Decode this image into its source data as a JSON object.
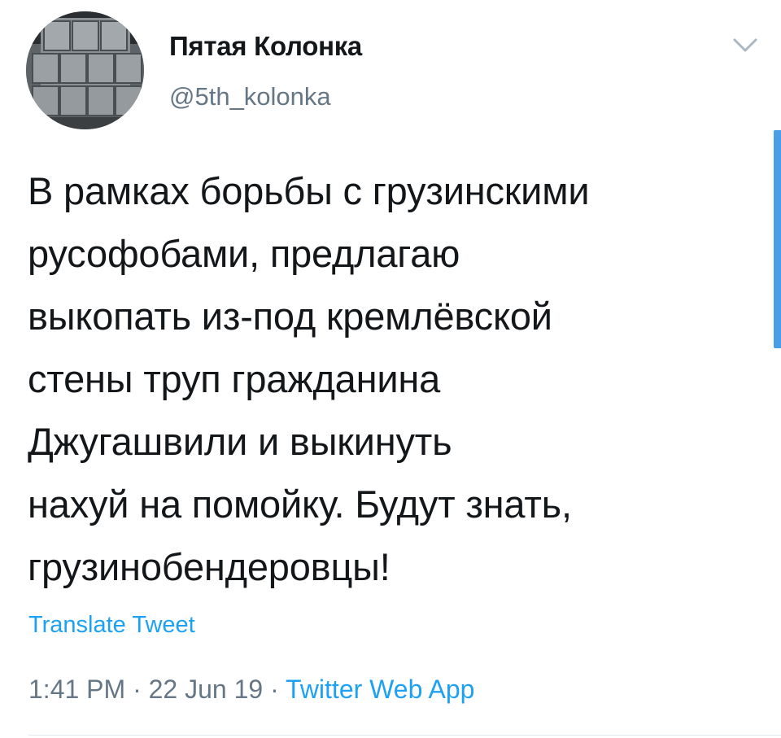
{
  "author": {
    "display_name": "Пятая Колонка",
    "handle": "@5th_kolonka"
  },
  "tweet": {
    "text_lines": [
      "В рамках борьбы с грузинскими",
      "русофобами, предлагаю",
      "выкопать из-под кремлёвской",
      "стены труп гражданина",
      "Джугашвили и выкинуть",
      "нахуй на помойку. Будут знать,",
      "грузинобендеровцы!"
    ],
    "translate_label": "Translate Tweet",
    "time": "1:41 PM",
    "separator": " · ",
    "date": "22 Jun 19",
    "source": "Twitter Web App"
  },
  "icons": {
    "menu": "chevron-down-icon",
    "avatar": "speaker-stack-image"
  },
  "colors": {
    "accent": "#1da1f2",
    "text": "#14171a",
    "secondary_text": "#657786",
    "divider": "#e1e8ed",
    "scrollbar": "#4a9ee8"
  }
}
